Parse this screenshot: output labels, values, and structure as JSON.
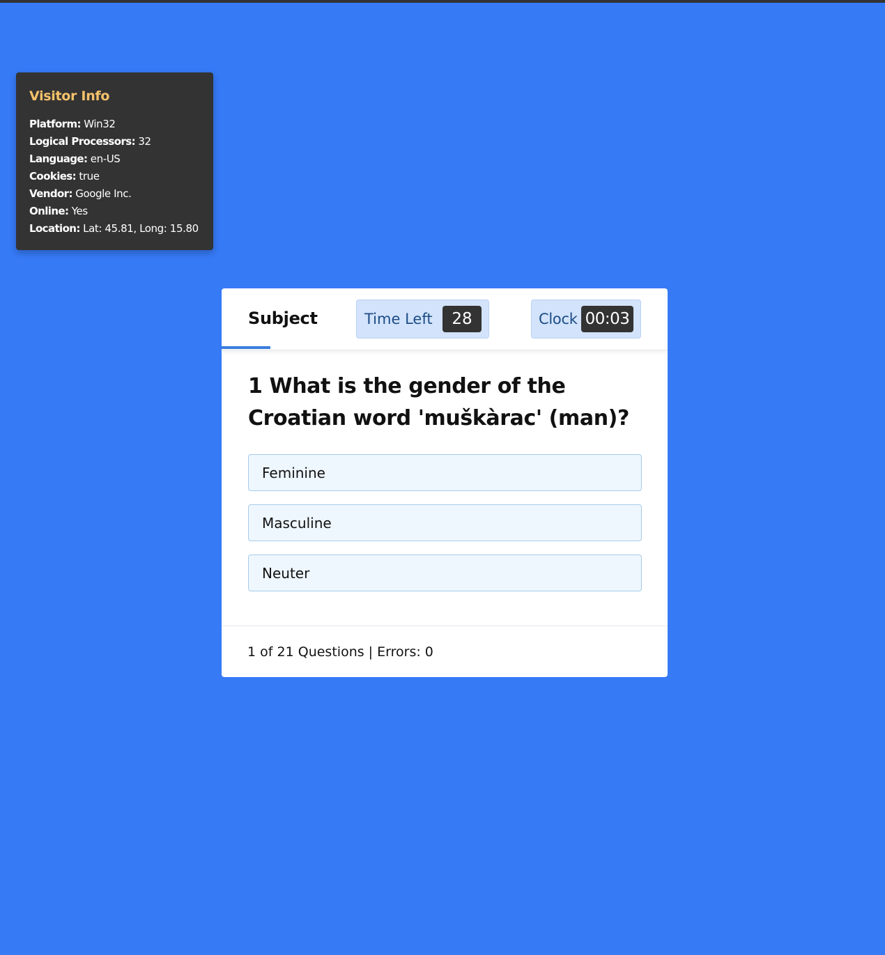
{
  "visitor_info": {
    "title": "Visitor Info",
    "rows": [
      {
        "label": "Platform:",
        "value": "Win32"
      },
      {
        "label": "Logical Processors:",
        "value": "32"
      },
      {
        "label": "Language:",
        "value": "en-US"
      },
      {
        "label": "Cookies:",
        "value": "true"
      },
      {
        "label": "Vendor:",
        "value": "Google Inc."
      },
      {
        "label": "Online:",
        "value": "Yes"
      },
      {
        "label": "Location:",
        "value": "Lat: 45.81, Long: 15.80"
      }
    ]
  },
  "quiz": {
    "tab_label": "Subject",
    "time_left_label": "Time Left",
    "time_left_value": "28",
    "clock_label": "Clock",
    "clock_value": "00:03",
    "question": "1 What is the gender of the Croatian word 'muškàrac' (man)?",
    "options": [
      "Feminine",
      "Masculine",
      "Neuter"
    ],
    "footer": {
      "current": "1",
      "of_text": "of",
      "total": "21",
      "questions_text": "Questions |",
      "errors_label": "Errors:",
      "errors_value": "0"
    }
  },
  "colors": {
    "background": "#367af6",
    "panel_dark": "#333333",
    "visitor_title": "#f5c26b",
    "accent": "#3b7ddd",
    "pill_bg": "#d2e3fb",
    "option_bg": "#eef6fe"
  }
}
